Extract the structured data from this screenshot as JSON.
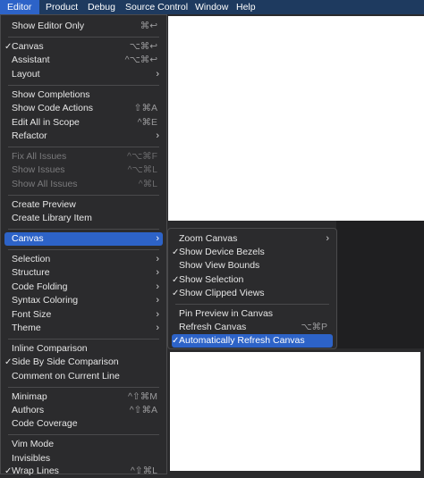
{
  "menubar": {
    "items": [
      "Editor",
      "Product",
      "Debug",
      "Source Control",
      "Window",
      "Help"
    ]
  },
  "editor_menu": {
    "show_editor_only": {
      "label": "Show Editor Only",
      "shortcut": "⌘↩"
    },
    "canvas": {
      "label": "Canvas",
      "shortcut": "⌥⌘↩",
      "checked": "✓"
    },
    "assistant": {
      "label": "Assistant",
      "shortcut": "^⌥⌘↩"
    },
    "layout": {
      "label": "Layout"
    },
    "show_completions": {
      "label": "Show Completions"
    },
    "show_code_actions": {
      "label": "Show Code Actions",
      "shortcut": "⇧⌘A"
    },
    "edit_all_in_scope": {
      "label": "Edit All in Scope",
      "shortcut": "^⌘E"
    },
    "refactor": {
      "label": "Refactor"
    },
    "fix_all_issues": {
      "label": "Fix All Issues",
      "shortcut": "^⌥⌘F"
    },
    "show_issues": {
      "label": "Show Issues",
      "shortcut": "^⌥⌘L"
    },
    "show_all_issues": {
      "label": "Show All Issues",
      "shortcut": "^⌘L"
    },
    "create_preview": {
      "label": "Create Preview"
    },
    "create_library_item": {
      "label": "Create Library Item"
    },
    "canvas_submenu": {
      "label": "Canvas"
    },
    "selection": {
      "label": "Selection"
    },
    "structure": {
      "label": "Structure"
    },
    "code_folding": {
      "label": "Code Folding"
    },
    "syntax_coloring": {
      "label": "Syntax Coloring"
    },
    "font_size": {
      "label": "Font Size"
    },
    "theme": {
      "label": "Theme"
    },
    "inline_comparison": {
      "label": "Inline Comparison"
    },
    "side_by_side": {
      "label": "Side By Side Comparison",
      "checked": "✓"
    },
    "comment_current_line": {
      "label": "Comment on Current Line"
    },
    "minimap": {
      "label": "Minimap",
      "shortcut": "^⇧⌘M"
    },
    "authors": {
      "label": "Authors",
      "shortcut": "^⇧⌘A"
    },
    "code_coverage": {
      "label": "Code Coverage"
    },
    "vim_mode": {
      "label": "Vim Mode"
    },
    "invisibles": {
      "label": "Invisibles"
    },
    "wrap_lines": {
      "label": "Wrap Lines",
      "shortcut": "^⇧⌘L",
      "checked": "✓"
    }
  },
  "canvas_menu": {
    "zoom_canvas": {
      "label": "Zoom Canvas"
    },
    "show_device_bezels": {
      "label": "Show Device Bezels",
      "checked": "✓"
    },
    "show_view_bounds": {
      "label": "Show View Bounds"
    },
    "show_selection": {
      "label": "Show Selection",
      "checked": "✓"
    },
    "show_clipped_views": {
      "label": "Show Clipped Views",
      "checked": "✓"
    },
    "pin_preview": {
      "label": "Pin Preview in Canvas"
    },
    "refresh_canvas": {
      "label": "Refresh Canvas",
      "shortcut": "⌥⌘P"
    },
    "auto_refresh": {
      "label": "Automatically Refresh Canvas",
      "checked": "✓"
    }
  },
  "icons": {
    "submenu_arrow": "›"
  }
}
